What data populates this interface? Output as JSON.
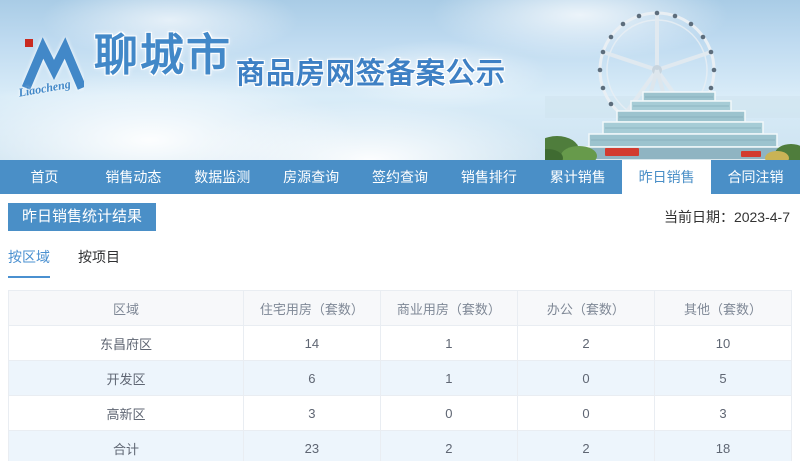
{
  "banner": {
    "logo_script": "Liaocheng",
    "city_name": "聊城市",
    "site_title": "商品房网签备案公示"
  },
  "nav": {
    "items": [
      {
        "key": "home",
        "label": "首页",
        "active": false
      },
      {
        "key": "sales-dynamics",
        "label": "销售动态",
        "active": false
      },
      {
        "key": "data-monitoring",
        "label": "数据监测",
        "active": false
      },
      {
        "key": "listing-query",
        "label": "房源查询",
        "active": false
      },
      {
        "key": "contract-query",
        "label": "签约查询",
        "active": false
      },
      {
        "key": "sales-ranking",
        "label": "销售排行",
        "active": false
      },
      {
        "key": "cumulative-sales",
        "label": "累计销售",
        "active": false
      },
      {
        "key": "yesterday-sales",
        "label": "昨日销售",
        "active": true
      },
      {
        "key": "contract-cancellation",
        "label": "合同注销",
        "active": false
      }
    ]
  },
  "content": {
    "section_title": "昨日销售统计结果",
    "date_label": "当前日期：2023-4-7",
    "tabs": [
      {
        "key": "by-region",
        "label": "按区域",
        "active": true
      },
      {
        "key": "by-project",
        "label": "按项目",
        "active": false
      }
    ]
  },
  "table": {
    "columns": [
      "区域",
      "住宅用房（套数）",
      "商业用房（套数）",
      "办公（套数）",
      "其他（套数）"
    ],
    "rows": [
      [
        "东昌府区",
        "14",
        "1",
        "2",
        "10"
      ],
      [
        "开发区",
        "6",
        "1",
        "0",
        "5"
      ],
      [
        "高新区",
        "3",
        "0",
        "0",
        "3"
      ],
      [
        "合计",
        "23",
        "2",
        "2",
        "18"
      ]
    ]
  },
  "colors": {
    "nav_blue": "#4a8fc7",
    "accent_blue": "#4a90d0",
    "title_blue": "#3e80c4",
    "stripe": "#edf5fc",
    "header_bg": "#f7f8fa",
    "logo_red": "#c92a20"
  }
}
